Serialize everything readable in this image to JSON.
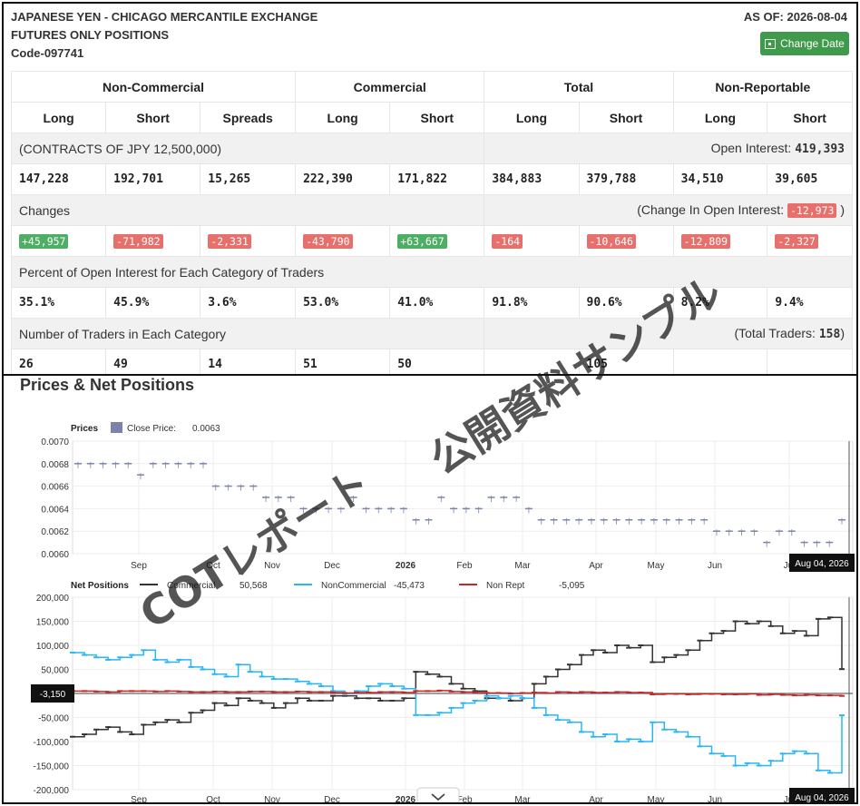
{
  "header": {
    "title_line1": "JAPANESE YEN - CHICAGO MERCANTILE EXCHANGE",
    "title_line2": "FUTURES ONLY POSITIONS",
    "code": "Code-097741",
    "as_of": "AS OF: 2026-08-04",
    "change_date_label": "Change Date"
  },
  "table": {
    "groups": [
      "Non-Commercial",
      "Commercial",
      "Total",
      "Non-Reportable"
    ],
    "subheaders": [
      "Long",
      "Short",
      "Spreads",
      "Long",
      "Short",
      "Long",
      "Short",
      "Long",
      "Short"
    ],
    "contracts_label": "(CONTRACTS OF JPY 12,500,000)",
    "open_interest_label": "Open Interest:",
    "open_interest_value": "419,393",
    "positions": [
      "147,228",
      "192,701",
      "15,265",
      "222,390",
      "171,822",
      "384,883",
      "379,788",
      "34,510",
      "39,605"
    ],
    "changes_label": "Changes",
    "change_oi_label": "(Change In Open Interest:",
    "change_oi_value": "-12,973",
    "change_oi_close": ")",
    "changes": [
      "+45,957",
      "-71,982",
      "-2,331",
      "-43,790",
      "+63,667",
      "-164",
      "-10,646",
      "-12,809",
      "-2,327"
    ],
    "percent_label": "Percent of Open Interest for Each Category of Traders",
    "percents": [
      "35.1%",
      "45.9%",
      "3.6%",
      "53.0%",
      "41.0%",
      "91.8%",
      "90.6%",
      "8.2%",
      "9.4%"
    ],
    "traders_label": "Number of Traders in Each Category",
    "total_traders_label": "(Total Traders:",
    "total_traders_value": "158",
    "total_traders_close": ")",
    "traders": [
      "26",
      "49",
      "14",
      "51",
      "50",
      "",
      "105",
      "",
      ""
    ]
  },
  "chart_section_title": "Prices & Net Positions",
  "watermark": {
    "line1": "COTレポート",
    "line2": "公開資料サンプル"
  },
  "chart_data": [
    {
      "type": "line",
      "title": "Prices",
      "legend": [
        {
          "name": "Close Price:",
          "value": "0.0063",
          "color": "#7b84a8"
        }
      ],
      "ylim": [
        0.006,
        0.007
      ],
      "yticks": [
        "0.0070",
        "0.0068",
        "0.0066",
        "0.0064",
        "0.0062",
        "0.0060"
      ],
      "xticks": [
        "Sep",
        "Oct",
        "Nov",
        "Dec",
        "2026",
        "Feb",
        "Mar",
        "Apr",
        "May",
        "Jun",
        "Jul"
      ],
      "x_month_index": [
        1,
        2,
        3,
        4,
        5,
        6,
        7,
        8,
        9,
        10,
        11
      ],
      "cursor_label": "Aug 04, 2026",
      "values": [
        0.0068,
        0.0068,
        0.0068,
        0.0068,
        0.0068,
        0.0067,
        0.0068,
        0.0068,
        0.0068,
        0.0068,
        0.0068,
        0.0066,
        0.0066,
        0.0066,
        0.0066,
        0.0065,
        0.0065,
        0.0065,
        0.0064,
        0.0064,
        0.0064,
        0.0064,
        0.0065,
        0.0064,
        0.0064,
        0.0064,
        0.0064,
        0.0063,
        0.0063,
        0.0065,
        0.0064,
        0.0064,
        0.0064,
        0.0065,
        0.0065,
        0.0065,
        0.0064,
        0.0063,
        0.0063,
        0.0063,
        0.0063,
        0.0063,
        0.0063,
        0.0063,
        0.0063,
        0.0063,
        0.0063,
        0.0063,
        0.0063,
        0.0063,
        0.0063,
        0.0062,
        0.0062,
        0.0062,
        0.0062,
        0.0061,
        0.0062,
        0.0062,
        0.0061,
        0.0061,
        0.0061,
        0.0063
      ]
    },
    {
      "type": "line",
      "title": "Net Positions",
      "ylim": [
        -200000,
        200000
      ],
      "yticks": [
        "200,000",
        "150,000",
        "100,000",
        "50,000",
        "0",
        "-50,000",
        "-100,000",
        "-150,000",
        "-200,000"
      ],
      "xticks": [
        "Sep",
        "Oct",
        "Nov",
        "Dec",
        "2026",
        "Feb",
        "Mar",
        "Apr",
        "May",
        "Jun",
        "Jul"
      ],
      "cursor_label": "Aug 04, 2026",
      "cursor_value_label": "-3,150",
      "series": [
        {
          "name": "Commercial",
          "legend_value": "50,568",
          "color": "#333333",
          "values": [
            -90000,
            -85000,
            -75000,
            -70000,
            -80000,
            -85000,
            -65000,
            -60000,
            -55000,
            -60000,
            -40000,
            -35000,
            -20000,
            -25000,
            -10000,
            -15000,
            -20000,
            -30000,
            -20000,
            -10000,
            -15000,
            -15000,
            -5000,
            -5000,
            -10000,
            -10000,
            -15000,
            -15000,
            -10000,
            45000,
            40000,
            35000,
            20000,
            10000,
            5000,
            -10000,
            -10000,
            -15000,
            -10000,
            20000,
            35000,
            50000,
            60000,
            80000,
            90000,
            85000,
            100000,
            95000,
            100000,
            65000,
            75000,
            80000,
            90000,
            110000,
            125000,
            130000,
            150000,
            145000,
            150000,
            140000,
            125000,
            130000,
            120000,
            155000,
            158000,
            50568
          ]
        },
        {
          "name": "NonCommercial",
          "legend_value": "-45,473",
          "color": "#29b6f6",
          "values": [
            85000,
            80000,
            75000,
            70000,
            75000,
            80000,
            90000,
            70000,
            65000,
            70000,
            55000,
            50000,
            40000,
            35000,
            60000,
            45000,
            35000,
            30000,
            30000,
            25000,
            20000,
            15000,
            5000,
            0,
            5000,
            15000,
            20000,
            15000,
            10000,
            -45000,
            -45000,
            -40000,
            -30000,
            -20000,
            -15000,
            -5000,
            -10000,
            -5000,
            -10000,
            -30000,
            -45000,
            -55000,
            -60000,
            -80000,
            -90000,
            -85000,
            -100000,
            -95000,
            -100000,
            -60000,
            -75000,
            -80000,
            -90000,
            -110000,
            -125000,
            -130000,
            -150000,
            -145000,
            -150000,
            -140000,
            -125000,
            -120000,
            -125000,
            -160000,
            -165000,
            -45473
          ]
        },
        {
          "name": "Non Rept",
          "legend_value": "-5,095",
          "color": "#c62828",
          "values": [
            5000,
            5000,
            4000,
            3000,
            5000,
            5000,
            5000,
            4000,
            5000,
            4000,
            3000,
            3000,
            4000,
            3000,
            3000,
            4000,
            4000,
            3000,
            3000,
            4000,
            3000,
            3000,
            2000,
            1000,
            2000,
            2000,
            3000,
            3000,
            2000,
            5000,
            5000,
            6000,
            4000,
            3000,
            2000,
            1000,
            1000,
            0,
            1000,
            2000,
            1000,
            3000,
            2000,
            3000,
            2000,
            2000,
            3000,
            2000,
            2000,
            -2000,
            -1000,
            -1000,
            -2000,
            -1000,
            -1000,
            -2000,
            -2000,
            -1000,
            -3000,
            -2000,
            -3000,
            -4000,
            -3000,
            -4000,
            -4000,
            -5095
          ]
        }
      ]
    }
  ]
}
